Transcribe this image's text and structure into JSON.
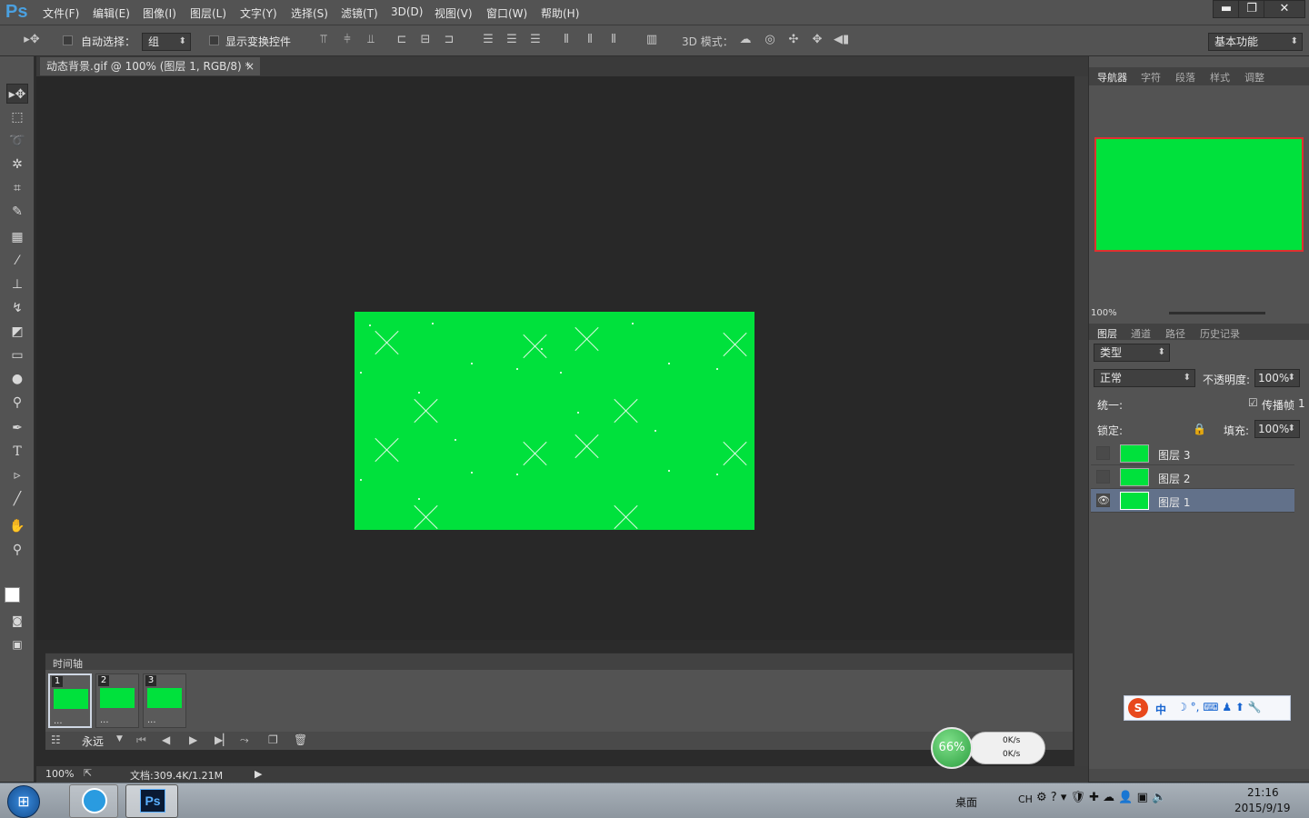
{
  "app": {
    "logo": "Ps"
  },
  "menu": [
    "文件(F)",
    "编辑(E)",
    "图像(I)",
    "图层(L)",
    "文字(Y)",
    "选择(S)",
    "滤镜(T)",
    "3D(D)",
    "视图(V)",
    "窗口(W)",
    "帮助(H)"
  ],
  "window_controls": {
    "minimize": "▬",
    "restore": "❐",
    "close": "✕"
  },
  "options": {
    "auto_select_label": "自动选择：",
    "auto_select_value": "组",
    "show_transform_label": "显示变换控件",
    "mode3d_label": "3D 模式：",
    "workspace": "基本功能"
  },
  "document": {
    "tab_title": "动态背景.gif @ 100% (图层 1, RGB/8) *",
    "close": "×"
  },
  "panels": {
    "top_tabs": [
      "导航器",
      "字符",
      "段落",
      "样式",
      "调整"
    ],
    "zoom": "100%",
    "layer_tabs": [
      "图层",
      "通道",
      "路径",
      "历史记录"
    ],
    "kind_filter": "类型",
    "blend_mode": "正常",
    "opacity_label": "不透明度:",
    "opacity_value": "100%",
    "unify_label": "统一:",
    "propagate_label": "传播帧",
    "propagate_value": "1",
    "lock_label": "锁定:",
    "fill_label": "填充:",
    "fill_value": "100%",
    "layers": [
      {
        "name": "图层 3",
        "visible": false
      },
      {
        "name": "图层 2",
        "visible": false
      },
      {
        "name": "图层 1",
        "visible": true,
        "selected": true
      }
    ]
  },
  "timeline": {
    "title": "时间轴",
    "frames": [
      {
        "num": "1",
        "delay": "..."
      },
      {
        "num": "2",
        "delay": "..."
      },
      {
        "num": "3",
        "delay": "..."
      }
    ],
    "loop": "永远"
  },
  "status": {
    "zoom": "100%",
    "doc_size": "文档:309.4K/1.21M"
  },
  "netmeter": {
    "percent": "66%",
    "up": "0K/s",
    "down": "0K/s"
  },
  "ime": {
    "mode": "中"
  },
  "taskbar": {
    "desktop": "桌面",
    "lang": "CH",
    "time": "21:16",
    "date": "2015/9/19"
  }
}
